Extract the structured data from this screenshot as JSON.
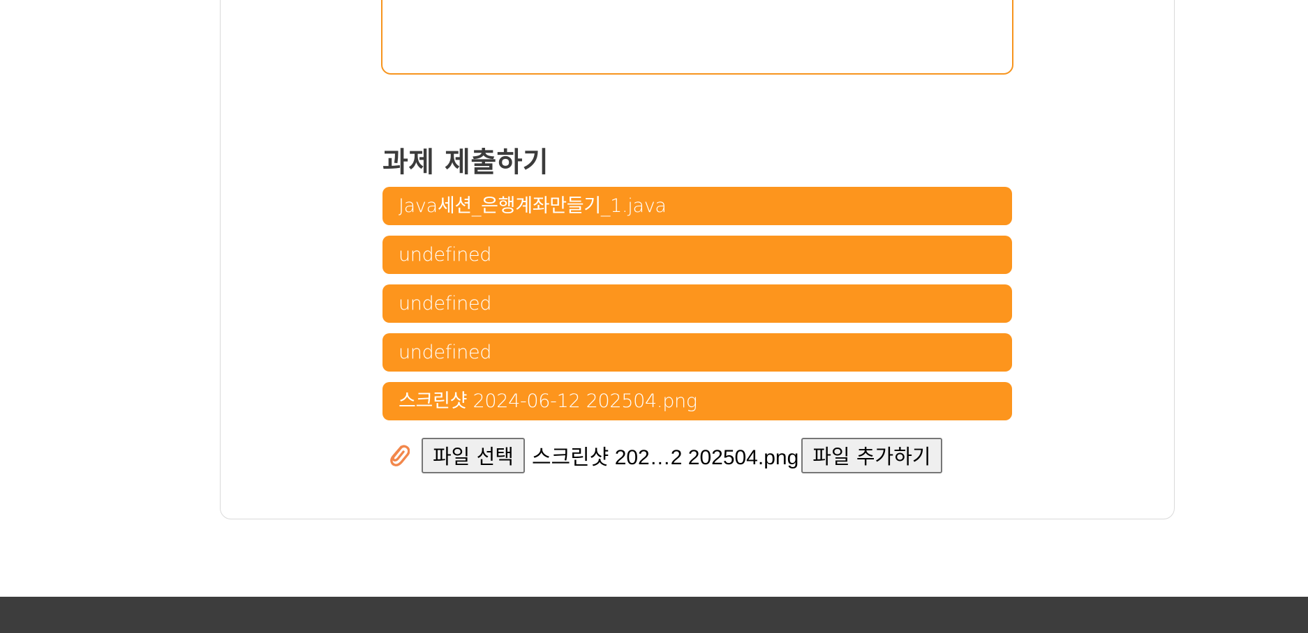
{
  "submission": {
    "title": "과제 제출하기",
    "files": [
      "Java세션_은행계좌만들기_1.java",
      "undefined",
      "undefined",
      "undefined",
      "스크린샷 2024-06-12 202504.png"
    ]
  },
  "upload": {
    "icon": "paperclip-icon",
    "choose_button": "파일 선택",
    "selected_file": "스크린샷 202…2 202504.png",
    "add_button": "파일 추가하기"
  },
  "colors": {
    "accent": "#fd951d",
    "footer": "#3d3d3d",
    "title": "#3b3b3b"
  }
}
